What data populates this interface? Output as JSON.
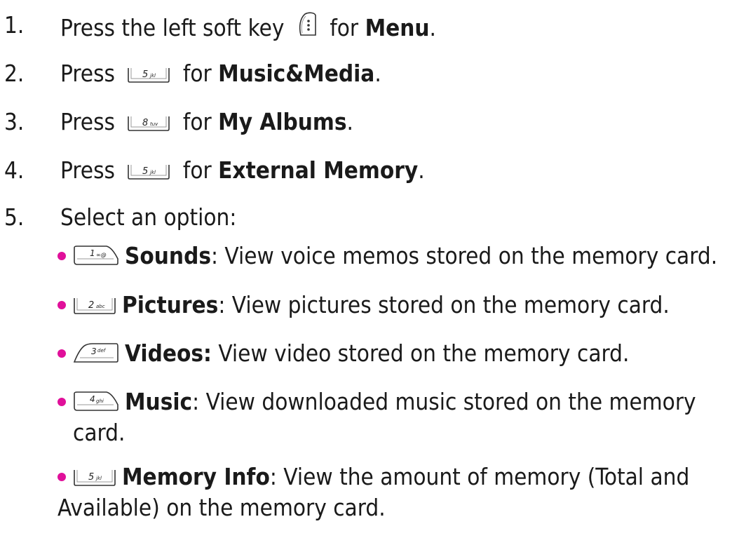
{
  "steps": [
    {
      "num": "1.",
      "pre": "Press the left soft key",
      "key": "softkey-left",
      "post": "for",
      "bold": "Menu",
      "end": "."
    },
    {
      "num": "2.",
      "pre": "Press",
      "key": "5 jkl",
      "post": "for",
      "bold": "Music&Media",
      "end": "."
    },
    {
      "num": "3.",
      "pre": "Press",
      "key": "8 tuv",
      "post": "for",
      "bold": "My Albums",
      "end": "."
    },
    {
      "num": "4.",
      "pre": "Press",
      "key": "5 jkl",
      "post": "for",
      "bold": "External Memory",
      "end": "."
    },
    {
      "num": "5.",
      "text": "Select an option:"
    }
  ],
  "options": [
    {
      "key": "1 ∞@",
      "bold": "Sounds",
      "text": ": View voice memos stored on the memory card."
    },
    {
      "key": "2 abc",
      "bold": "Pictures",
      "text": ": View pictures stored on the memory card."
    },
    {
      "key": "3 def",
      "bold": "Videos:",
      "text": " View video stored on the memory card."
    },
    {
      "key": "4 ghi",
      "bold": "Music",
      "text": ": View downloaded music stored on the memory",
      "cont": "card."
    },
    {
      "key": "5 jkl",
      "bold": "Memory Info",
      "text": ": View the amount of memory (Total and",
      "cont": "Available) on the memory card."
    }
  ],
  "keys": {
    "k5": {
      "digit": "5",
      "letters": "jkl"
    },
    "k8": {
      "digit": "8",
      "letters": "tuv"
    },
    "k1": {
      "digit": "1",
      "letters": "∞@"
    },
    "k2": {
      "digit": "2",
      "letters": "abc"
    },
    "k3": {
      "digit": "3",
      "letters": "def"
    },
    "k4": {
      "digit": "4",
      "letters": "ghi"
    }
  }
}
